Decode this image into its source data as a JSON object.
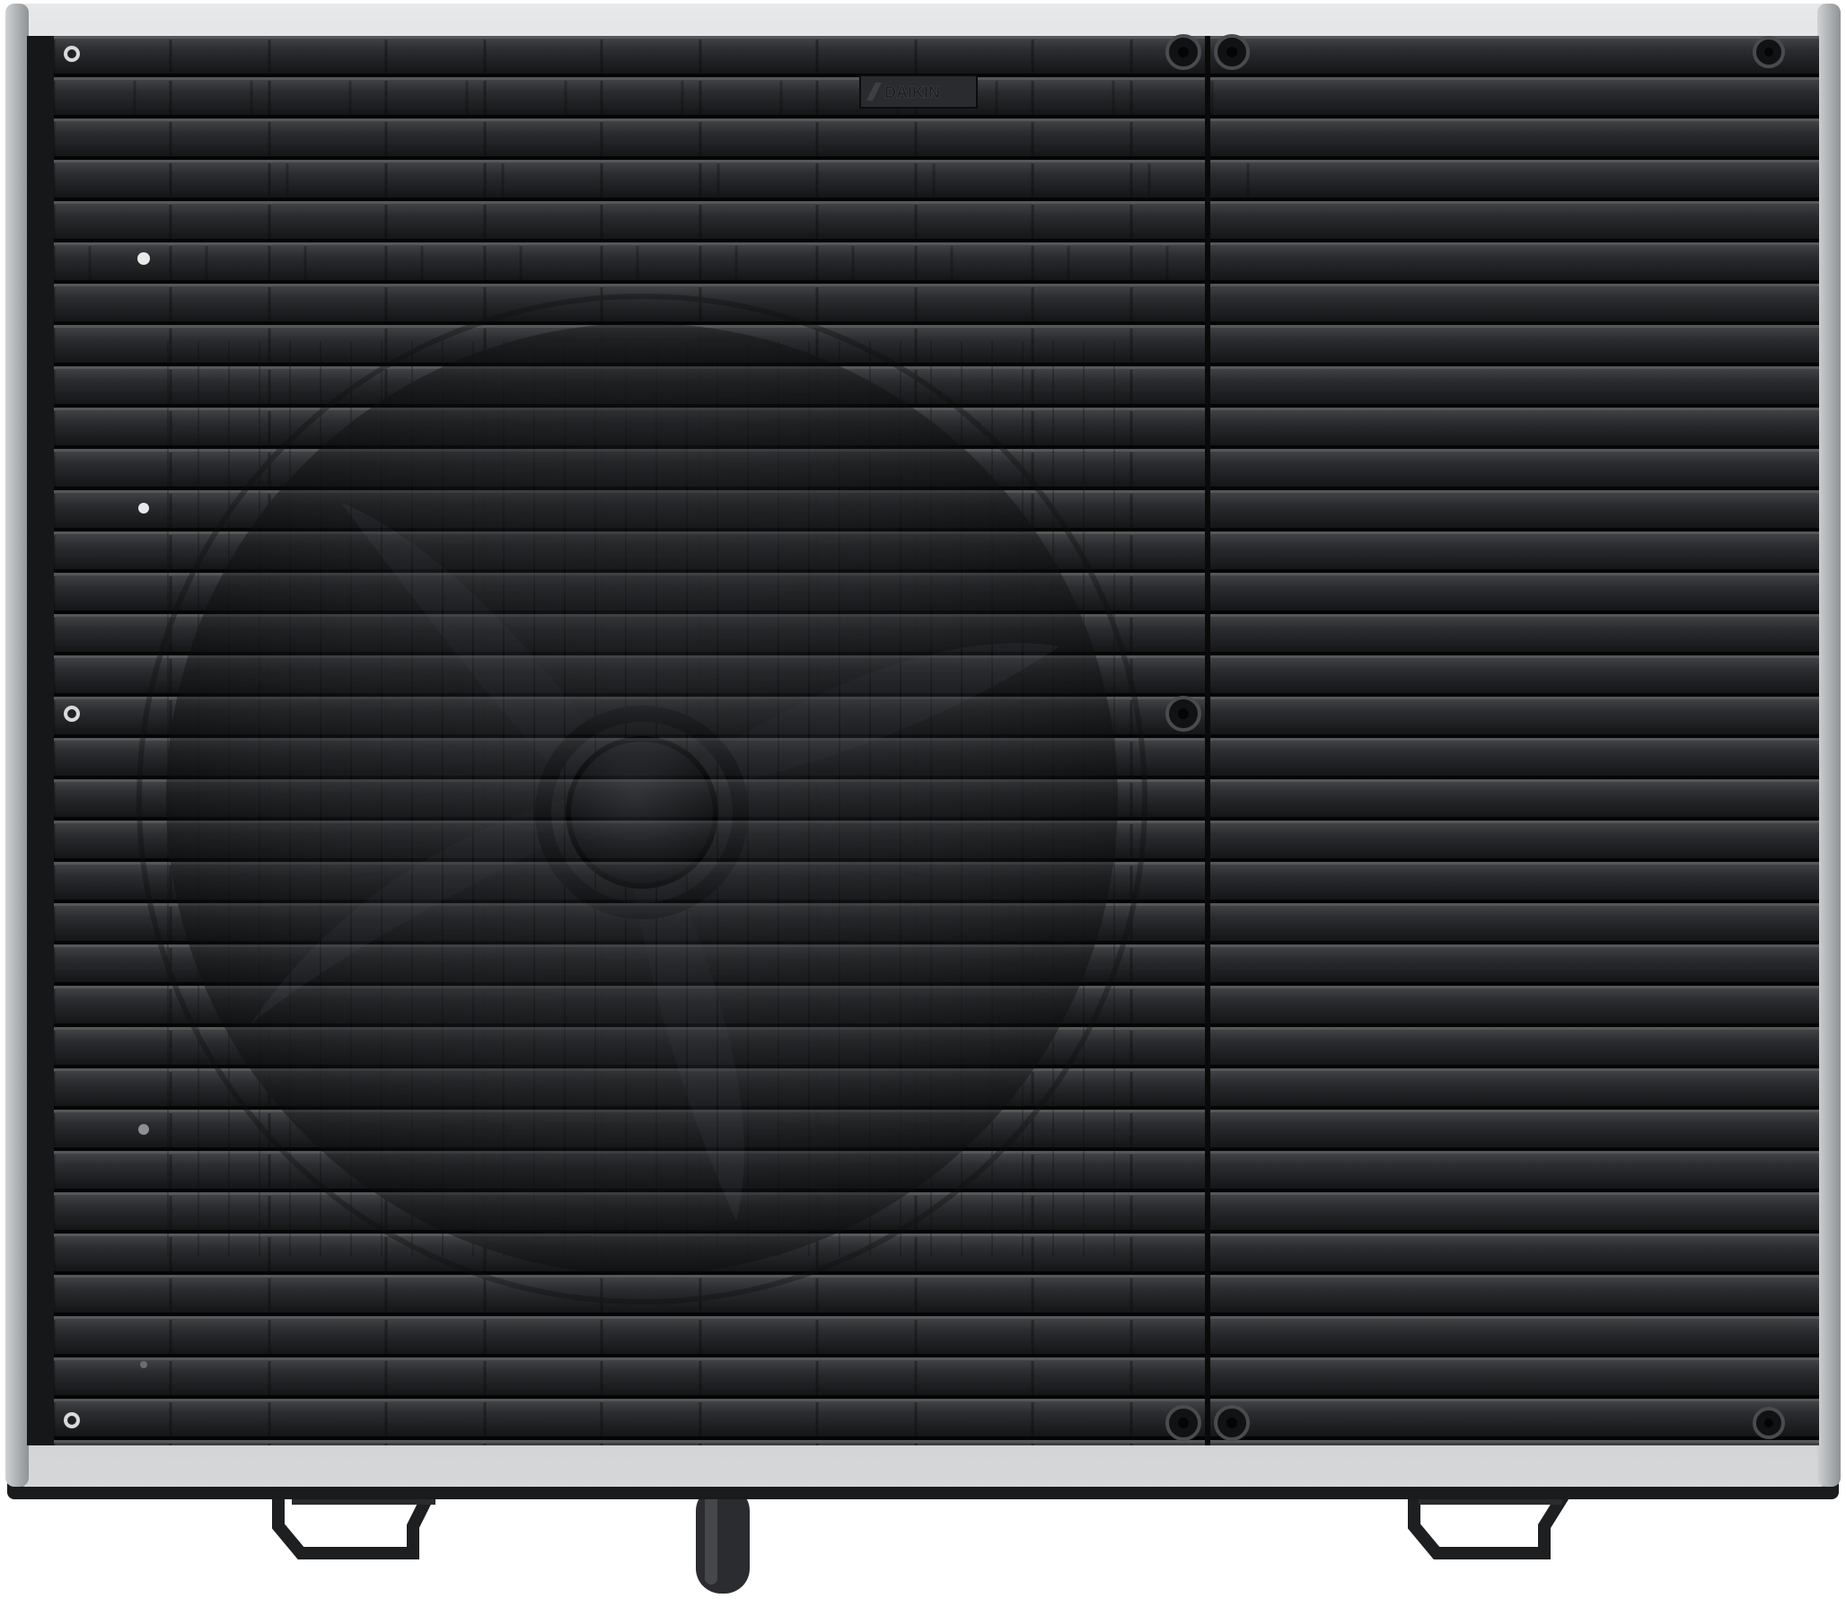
{
  "product": {
    "brand_logo_text": "DAIKIN",
    "colors": {
      "background": "#ffffff",
      "frame_silver": "#b9bcbf",
      "body_dark": "#2c2d2f",
      "louver_dark": "#1a1b1d",
      "louver_highlight": "#3a3b3e",
      "fan_shroud": "#0d0e10",
      "screw": "#0a0a0a"
    }
  }
}
